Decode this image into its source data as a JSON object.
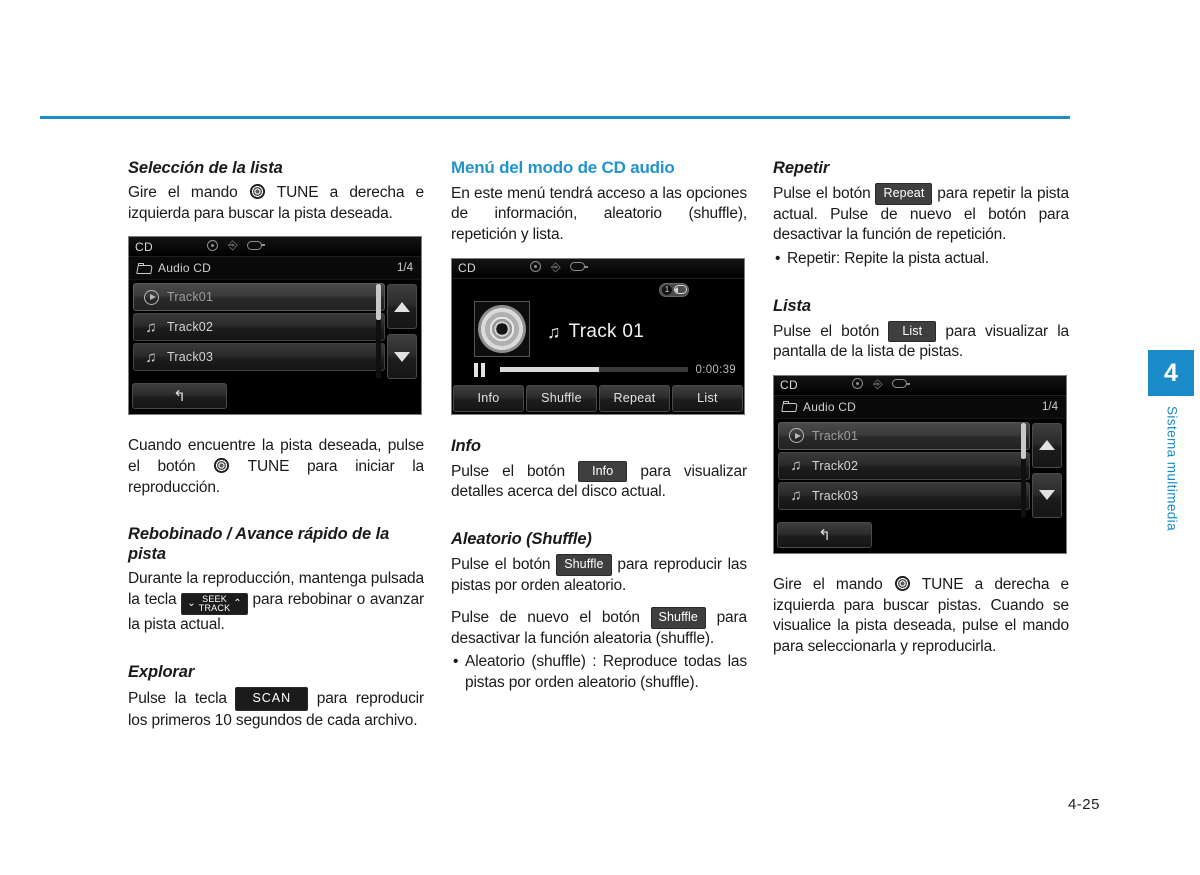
{
  "page": {
    "folio": "4-25",
    "rule_color": "#1c8ec4",
    "accent_color": "#1b8cc9"
  },
  "side_tab": {
    "chapter_number": "4",
    "chapter_label": "Sistema multimedia"
  },
  "columns": {
    "left": {
      "heading_1": "Selección de la lista",
      "para_1_a": "Gire el mando ",
      "para_1_knob": "knob-icon",
      "para_1_b": " TUNE a derecha e izquierda para buscar la pista deseada.",
      "para_2_a": "Cuando encuentre la pista deseada, pulse el botón ",
      "para_2_b": " TUNE para iniciar la reproducción.",
      "heading_2": "Rebobinado / Avance rápido de la pista",
      "para_3_a": "Durante la reproducción, mantenga pulsada la tecla ",
      "seek_key_top": "SEEK",
      "seek_key_bottom": "TRACK",
      "seek_chev_left": "⌄",
      "seek_chev_right": "⌃",
      "para_3_b": " para rebobinar o avanzar la pista actual.",
      "heading_3": "Explorar",
      "para_4_a": "Pulse la tecla ",
      "scan_key": "SCAN",
      "para_4_b": " para reproducir los primeros 10 segundos de cada archivo."
    },
    "middle": {
      "heading_1": "Menú del modo de CD audio",
      "para_1": "En este menú tendrá acceso a las opciones de información, aleatorio (shuffle), repetición y lista.",
      "heading_2": "Info",
      "para_2_a": "Pulse el botón ",
      "info_key": "Info",
      "para_2_b": " para visualizar detalles acerca del disco actual.",
      "heading_3": "Aleatorio (Shuffle)",
      "para_3_a": "Pulse el botón ",
      "shuffle_key": "Shuffle",
      "para_3_b": " para reproducir las pistas por orden aleatorio.",
      "para_4_a": "Pulse de nuevo el botón ",
      "para_4_b": " para desactivar la función aleatoria (shuffle).",
      "bullet_1": "Aleatorio (shuffle) : Reproduce todas las pistas por orden aleatorio (shuffle)."
    },
    "right": {
      "heading_1": "Repetir",
      "para_1_a": "Pulse el botón ",
      "repeat_key": "Repeat",
      "para_1_b": " para repetir la pista actual. Pulse de nuevo el botón para desactivar la función de repetición.",
      "bullet_1": "Repetir: Repite la pista actual.",
      "heading_2": "Lista",
      "para_2_a": "Pulse el botón ",
      "list_key": "List",
      "para_2_b": " para visualizar la pantalla de la lista de pistas.",
      "para_3_a": "Gire el mando ",
      "para_3_b": " TUNE a derecha e izquierda para buscar pistas. Cuando se visualice la pista deseada, pulse el mando para seleccionarla y reproducirla."
    }
  },
  "screens": {
    "list_screen_left": {
      "source": "CD",
      "status_icons": [
        "disc-icon",
        "usb-icon",
        "aux-icon"
      ],
      "folder_label": "Audio CD",
      "page_count": "1/4",
      "tracks": [
        {
          "label": "Track01",
          "icon": "play-icon",
          "active": true
        },
        {
          "label": "Track02",
          "icon": "music-note-icon",
          "active": false
        },
        {
          "label": "Track03",
          "icon": "music-note-icon",
          "active": false
        }
      ],
      "scroll_up": "▲",
      "scroll_down": "▼",
      "back_button": "↰"
    },
    "player_screen": {
      "source": "CD",
      "status_icons": [
        "disc-icon",
        "usb-icon",
        "aux-icon"
      ],
      "repeat_indicator": "1",
      "album_art": "cd-disc-art",
      "track_title": "Track 01",
      "track_icon": "music-note-icon",
      "transport_state": "pause-icon",
      "elapsed_time": "0:00:39",
      "progress_percent": 53,
      "soft_keys": [
        "Info",
        "Shuffle",
        "Repeat",
        "List"
      ]
    },
    "list_screen_right": {
      "source": "CD",
      "status_icons": [
        "disc-icon",
        "usb-icon",
        "aux-icon"
      ],
      "folder_label": "Audio CD",
      "page_count": "1/4",
      "tracks": [
        {
          "label": "Track01",
          "icon": "play-icon",
          "active": true
        },
        {
          "label": "Track02",
          "icon": "music-note-icon",
          "active": false
        },
        {
          "label": "Track03",
          "icon": "music-note-icon",
          "active": false
        }
      ],
      "scroll_up": "▲",
      "scroll_down": "▼",
      "back_button": "↰"
    }
  }
}
